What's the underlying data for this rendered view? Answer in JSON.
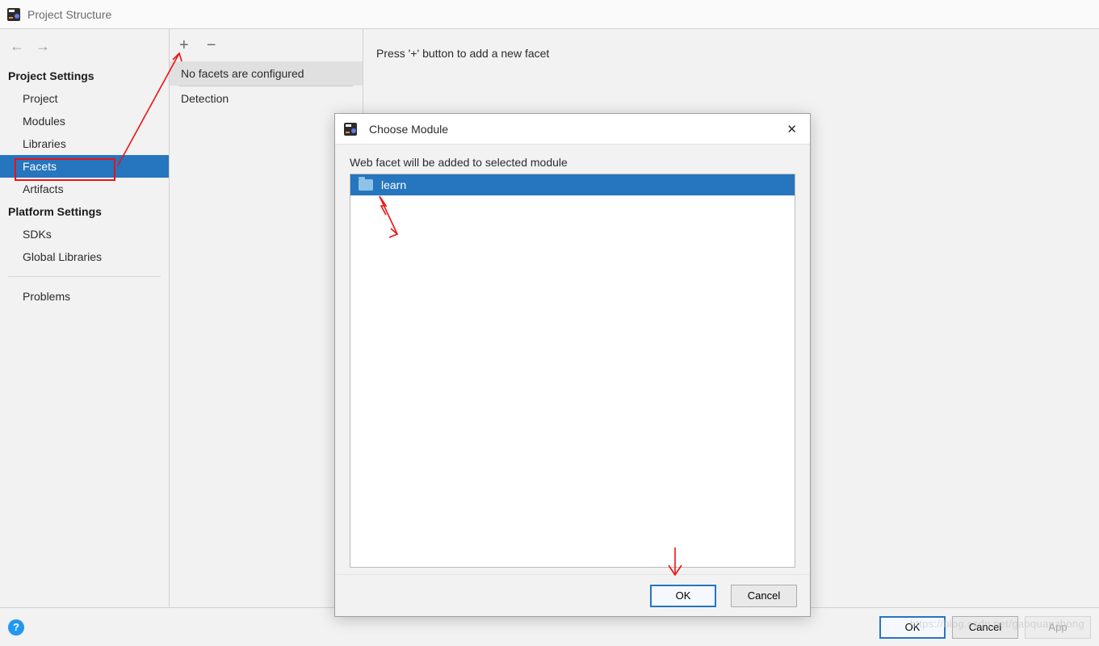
{
  "window_title": "Project Structure",
  "nav": {
    "back_glyph": "←",
    "fwd_glyph": "→"
  },
  "sidebar": {
    "heading_project": "Project Settings",
    "items_project": [
      "Project",
      "Modules",
      "Libraries",
      "Facets",
      "Artifacts"
    ],
    "selected_project_item_index": 3,
    "heading_platform": "Platform Settings",
    "items_platform": [
      "SDKs",
      "Global Libraries"
    ],
    "problems_label": "Problems"
  },
  "midlist": {
    "add_glyph": "+",
    "remove_glyph": "−",
    "row_main": "No facets are configured",
    "row_secondary": "Detection"
  },
  "content": {
    "hint": "Press '+' button to add a new facet"
  },
  "dialog": {
    "title": "Choose Module",
    "description": "Web facet will be added to selected module",
    "modules": [
      "learn"
    ],
    "ok_label": "OK",
    "cancel_label": "Cancel"
  },
  "bottombar": {
    "help_glyph": "?",
    "ok_label": "OK",
    "cancel_label": "Cancel",
    "apply_label": "App"
  },
  "watermark": "https://blog.csdn.net/gaoquanzhong"
}
